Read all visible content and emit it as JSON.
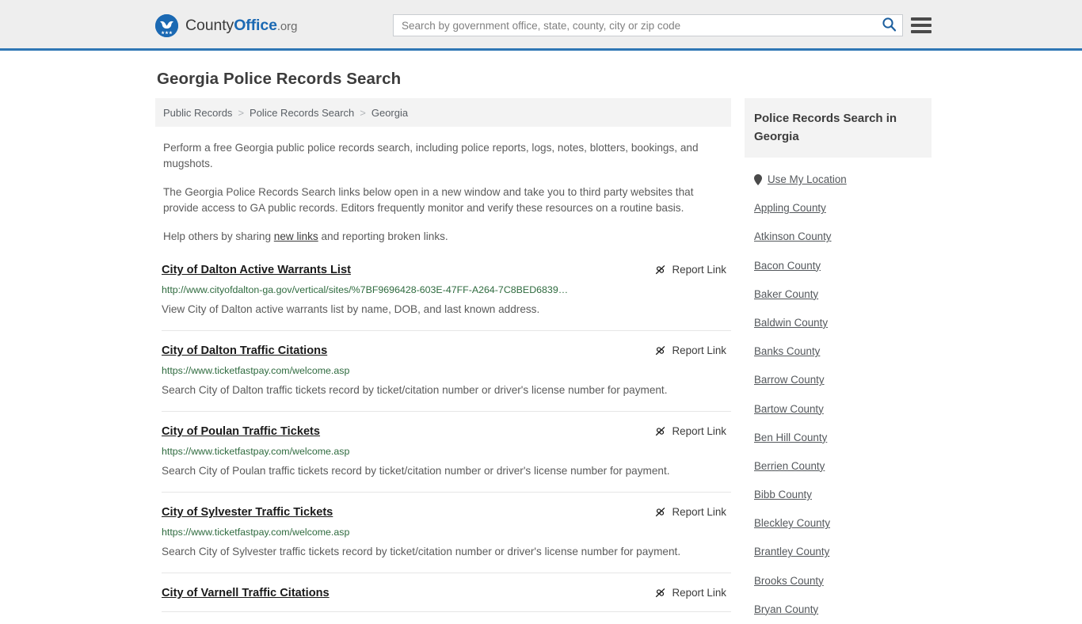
{
  "header": {
    "brand": {
      "part1": "County",
      "part2": "Office",
      "part3": ".org",
      "logo_icon": "eagle-stars-logo-icon"
    },
    "search": {
      "placeholder": "Search by government office, state, county, city or zip code",
      "value": "",
      "icon": "search-icon"
    },
    "menu_icon": "hamburger-menu-icon",
    "accent_color": "#2f76b4",
    "background_color": "#eeeeee"
  },
  "page": {
    "title": "Georgia Police Records Search"
  },
  "breadcrumb": {
    "items": [
      "Public Records",
      "Police Records Search",
      "Georgia"
    ],
    "separator": ">"
  },
  "intro": {
    "paragraph1": "Perform a free Georgia public police records search, including police reports, logs, notes, blotters, bookings, and mugshots.",
    "paragraph2": "The Georgia Police Records Search links below open in a new window and take you to third party websites that provide access to GA public records. Editors frequently monitor and verify these resources on a routine basis.",
    "paragraph3_pre": "Help others by sharing ",
    "paragraph3_link": "new links",
    "paragraph3_post": " and reporting broken links."
  },
  "report_link": {
    "label": "Report Link",
    "icon": "broken-link-icon"
  },
  "results": [
    {
      "title": "City of Dalton Active Warrants List",
      "url": "http://www.cityofdalton-ga.gov/vertical/sites/%7BF9696428-603E-47FF-A264-7C8BED6839…",
      "description": "View City of Dalton active warrants list by name, DOB, and last known address."
    },
    {
      "title": "City of Dalton Traffic Citations",
      "url": "https://www.ticketfastpay.com/welcome.asp",
      "description": "Search City of Dalton traffic tickets record by ticket/citation number or driver's license number for payment."
    },
    {
      "title": "City of Poulan Traffic Tickets",
      "url": "https://www.ticketfastpay.com/welcome.asp",
      "description": "Search City of Poulan traffic tickets record by ticket/citation number or driver's license number for payment."
    },
    {
      "title": "City of Sylvester Traffic Tickets",
      "url": "https://www.ticketfastpay.com/welcome.asp",
      "description": "Search City of Sylvester traffic tickets record by ticket/citation number or driver's license number for payment."
    },
    {
      "title": "City of Varnell Traffic Citations",
      "url": "",
      "description": ""
    }
  ],
  "sidebar": {
    "heading": "Police Records Search in Georgia",
    "items": [
      {
        "label": "Use My Location",
        "icon": "map-pin-icon"
      },
      {
        "label": "Appling County",
        "icon": ""
      },
      {
        "label": "Atkinson County",
        "icon": ""
      },
      {
        "label": "Bacon County",
        "icon": ""
      },
      {
        "label": "Baker County",
        "icon": ""
      },
      {
        "label": "Baldwin County",
        "icon": ""
      },
      {
        "label": "Banks County",
        "icon": ""
      },
      {
        "label": "Barrow County",
        "icon": ""
      },
      {
        "label": "Bartow County",
        "icon": ""
      },
      {
        "label": "Ben Hill County",
        "icon": ""
      },
      {
        "label": "Berrien County",
        "icon": ""
      },
      {
        "label": "Bibb County",
        "icon": ""
      },
      {
        "label": "Bleckley County",
        "icon": ""
      },
      {
        "label": "Brantley County",
        "icon": ""
      },
      {
        "label": "Brooks County",
        "icon": ""
      },
      {
        "label": "Bryan County",
        "icon": ""
      }
    ]
  },
  "colors": {
    "url_green": "#2f6b3f",
    "link_blue": "#1b69b3",
    "text_gray": "#5b5b5b"
  }
}
